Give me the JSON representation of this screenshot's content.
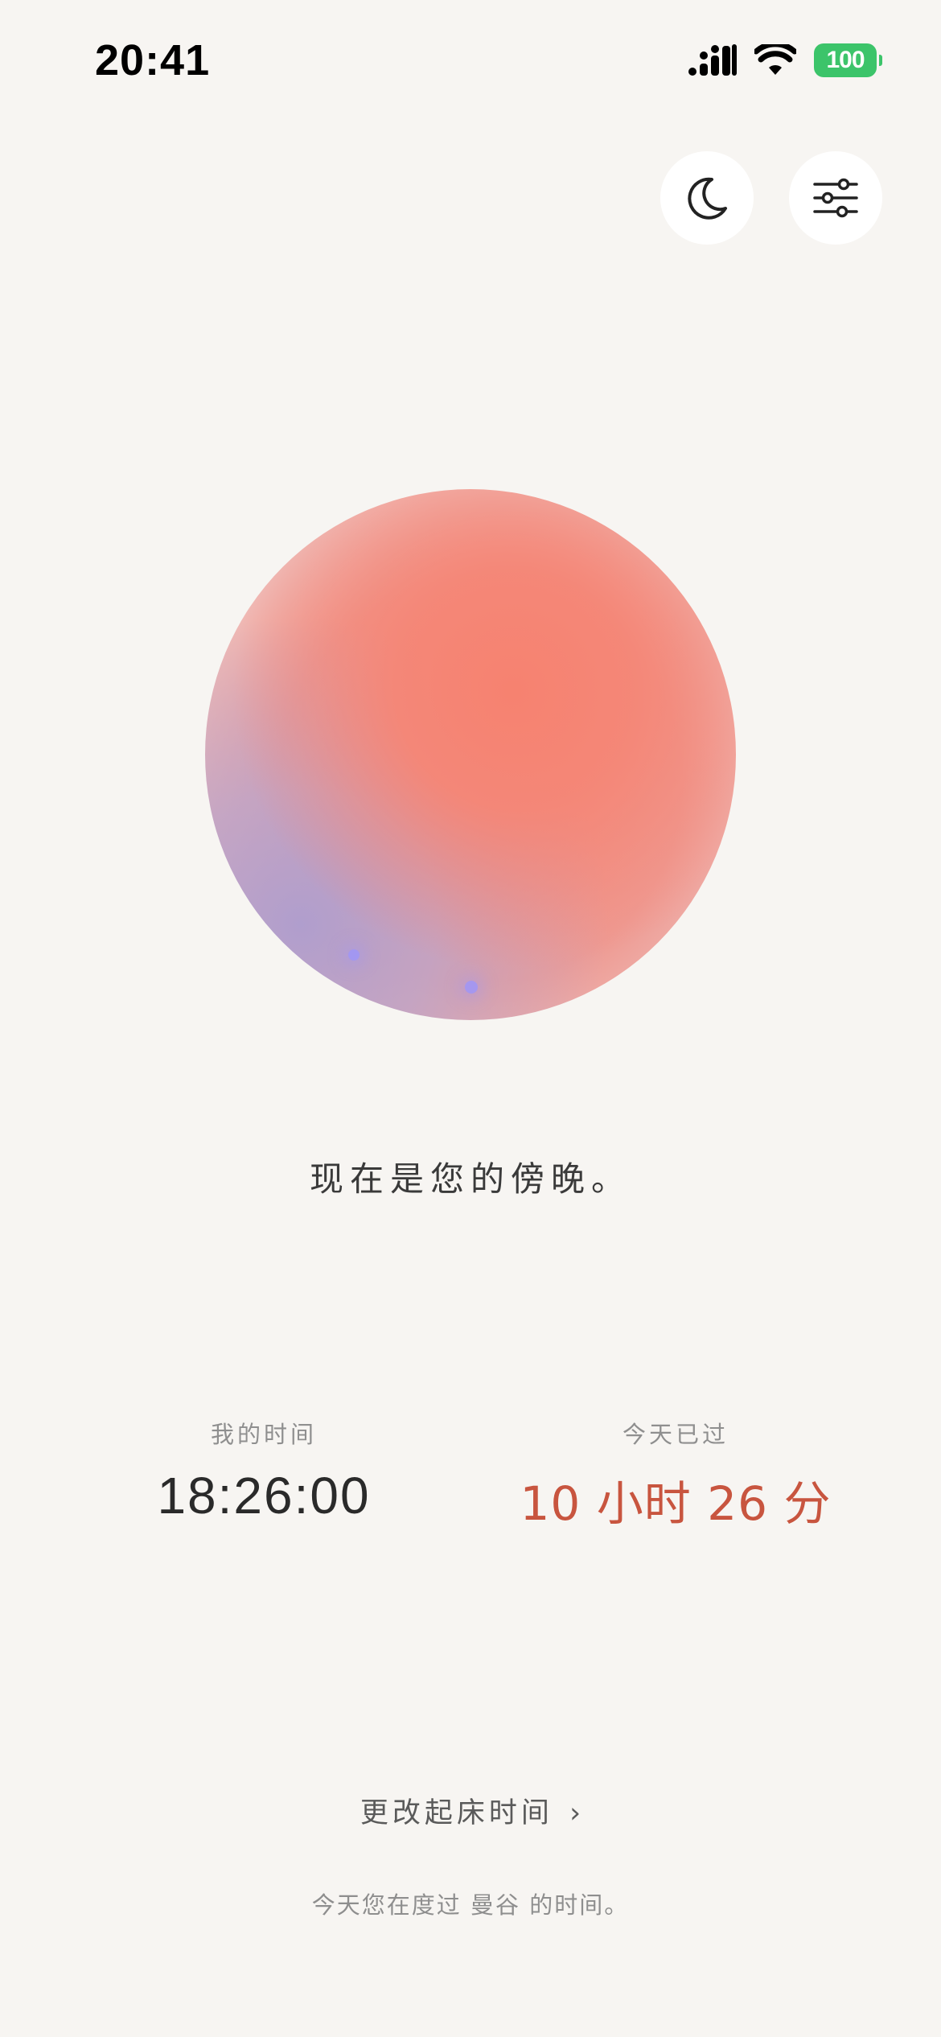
{
  "status_bar": {
    "time": "20:41",
    "battery": "100",
    "icons": [
      "cellular-signal-icon",
      "wifi-icon",
      "battery-icon"
    ],
    "battery_color": "#3cc46a"
  },
  "header": {
    "buttons": [
      {
        "name": "night-mode-button",
        "icon": "moon-icon"
      },
      {
        "name": "settings-button",
        "icon": "sliders-icon"
      }
    ]
  },
  "orb": {
    "colors": [
      "#f5857a",
      "#f08d82",
      "#b8a3cc",
      "#f6dcdb"
    ]
  },
  "greeting": "现在是您的傍晚。",
  "stats": {
    "my_time": {
      "label": "我的时间",
      "value": "18:26:00"
    },
    "elapsed_today": {
      "label": "今天已过",
      "value": "10 小时 26 分",
      "color": "#c8553f"
    }
  },
  "change_wake_time": {
    "label": "更改起床时间",
    "chevron": "›"
  },
  "footnote": "今天您在度过 曼谷 的时间。",
  "colors": {
    "background": "#f7f5f2",
    "accent": "#c8553f"
  }
}
